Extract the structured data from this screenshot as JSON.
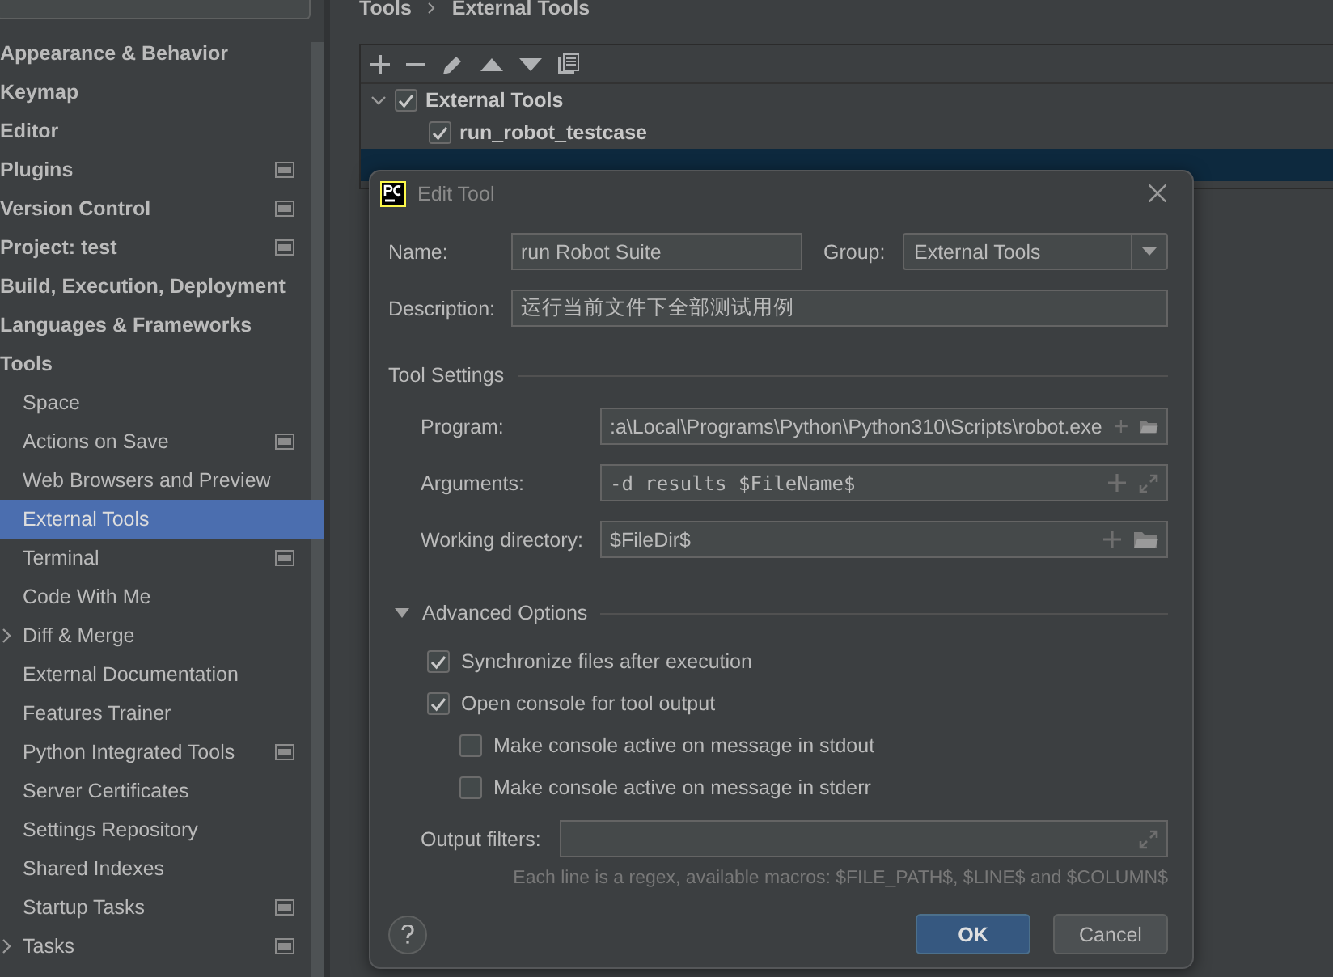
{
  "sidebar": {
    "items": [
      {
        "label": "Appearance & Behavior",
        "selected": false,
        "project_level": false
      },
      {
        "label": "Keymap",
        "selected": false,
        "project_level": false
      },
      {
        "label": "Editor",
        "selected": false,
        "project_level": false
      },
      {
        "label": "Plugins",
        "selected": false,
        "project_level": true
      },
      {
        "label": "Version Control",
        "selected": false,
        "project_level": true
      },
      {
        "label": "Project: test",
        "selected": false,
        "project_level": true
      },
      {
        "label": "Build, Execution, Deployment",
        "selected": false,
        "project_level": false
      },
      {
        "label": "Languages & Frameworks",
        "selected": false,
        "project_level": false
      },
      {
        "label": "Tools",
        "selected": false,
        "project_level": false,
        "children": [
          {
            "label": "Space",
            "selected": false,
            "project_level": false,
            "collapsed": false
          },
          {
            "label": "Actions on Save",
            "selected": false,
            "project_level": true,
            "collapsed": false
          },
          {
            "label": "Web Browsers and Preview",
            "selected": false,
            "project_level": false,
            "collapsed": false
          },
          {
            "label": "External Tools",
            "selected": true,
            "project_level": false,
            "collapsed": false
          },
          {
            "label": "Terminal",
            "selected": false,
            "project_level": true,
            "collapsed": false
          },
          {
            "label": "Code With Me",
            "selected": false,
            "project_level": false,
            "collapsed": false
          },
          {
            "label": "Diff & Merge",
            "selected": false,
            "project_level": false,
            "collapsed": true
          },
          {
            "label": "External Documentation",
            "selected": false,
            "project_level": false,
            "collapsed": false
          },
          {
            "label": "Features Trainer",
            "selected": false,
            "project_level": false,
            "collapsed": false
          },
          {
            "label": "Python Integrated Tools",
            "selected": false,
            "project_level": true,
            "collapsed": false
          },
          {
            "label": "Server Certificates",
            "selected": false,
            "project_level": false,
            "collapsed": false
          },
          {
            "label": "Settings Repository",
            "selected": false,
            "project_level": false,
            "collapsed": false
          },
          {
            "label": "Shared Indexes",
            "selected": false,
            "project_level": false,
            "collapsed": false
          },
          {
            "label": "Startup Tasks",
            "selected": false,
            "project_level": true,
            "collapsed": false
          },
          {
            "label": "Tasks",
            "selected": false,
            "project_level": true,
            "collapsed": true
          }
        ]
      }
    ]
  },
  "breadcrumb": [
    "Tools",
    "External Tools"
  ],
  "tree": {
    "label": "External Tools",
    "checked": true,
    "expanded": true,
    "selected": false,
    "children": [
      {
        "label": "run_robot_testcase",
        "checked": true,
        "selected": false
      },
      {
        "selected": true
      }
    ]
  },
  "dialog": {
    "title": "Edit Tool",
    "name_label": "Name:",
    "name_value": "run Robot Suite",
    "group_label": "Group:",
    "group_value": "External Tools",
    "description_label": "Description:",
    "description_value": "运行当前文件下全部测试用例",
    "tool_settings": {
      "title": "Tool Settings",
      "rows": [
        {
          "label": "Program:",
          "value": ":a\\Local\\Programs\\Python\\Python310\\Scripts\\robot.exe",
          "kind": "text",
          "browsable": true
        },
        {
          "label": "Arguments:",
          "value": "-d results $FileName$",
          "kind": "mono",
          "browsable": false
        },
        {
          "label": "Working directory:",
          "value": "$FileDir$",
          "kind": "text",
          "browsable": true
        }
      ]
    },
    "advanced": {
      "title": "Advanced Options",
      "expanded": true,
      "options": [
        {
          "label": "Synchronize files after execution",
          "checked": true
        },
        {
          "label": "Open console for tool output",
          "checked": true,
          "children": [
            {
              "label": "Make console active on message in stdout",
              "checked": false
            },
            {
              "label": "Make console active on message in stderr",
              "checked": false
            }
          ]
        }
      ],
      "output_filters_label": "Output filters:",
      "hint": "Each line is a regex, available macros: $FILE_PATH$, $LINE$ and $COLUMN$"
    },
    "buttons": [
      {
        "label": "OK",
        "kind": "primary"
      },
      {
        "label": "Cancel",
        "kind": "secondary"
      }
    ]
  }
}
